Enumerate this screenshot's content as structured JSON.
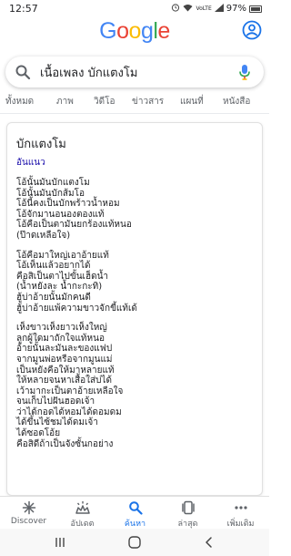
{
  "status_bar": {
    "time": "12:57",
    "battery": "97%",
    "network": "VoLTE"
  },
  "header": {
    "logo_letters": [
      {
        "char": "G",
        "color": "#4285F4"
      },
      {
        "char": "o",
        "color": "#EA4335"
      },
      {
        "char": "o",
        "color": "#FBBC05"
      },
      {
        "char": "g",
        "color": "#4285F4"
      },
      {
        "char": "l",
        "color": "#34A853"
      },
      {
        "char": "e",
        "color": "#EA4335"
      }
    ],
    "account_icon": "account-circle-icon"
  },
  "search": {
    "query": "เนื้อเพลง บักแตงโม"
  },
  "tabs": [
    "ทั้งหมด",
    "ภาพ",
    "วิดีโอ",
    "ข่าวสาร",
    "แผนที่",
    "หนังสือ"
  ],
  "result": {
    "title": "บักแตงโม",
    "artist": "อันแนว",
    "stanzas": [
      [
        "โอ้นั้นมันบักแตงโม",
        "โอ้นั้นมันบักส้มโอ",
        "โอ้นี้คงเป็นบักพร้าวน้ำหอม",
        "โอ้จักมานอนองตองแท้",
        "โอ้คือเป็นตามันยกร้องแท้หนอ",
        "(ป๊าดเหลือใจ)"
      ],
      [
        "โอ้คือมาใหญ่เอาอ้ายแท้",
        "โอ้เห็นแล้วอยากได้",
        "คือสิเป็นตาไปขั้นเฮ็ดน้ำ",
        "(น้ำหยังละ น้ำกะกะทิ)",
        "ฮู้บ่าอ้ายนั้นมักคนดี",
        "ฮู้บ่าอ้ายแพ้ความขาวจักขี้แท้เด้"
      ],
      [
        "เห็งขาวเห็งยาวเห็งใหญ่",
        "ลูกผู้ใดมาถักใจแท้หนอ",
        "อ้ายนั้นละมันละของแฟป",
        "จากมูนพ่อหรือจากมูนแม่",
        "เป็นหยังคือให้มาหลายแท้",
        "ให้หลายจนหาเสื้อใส่บ่ได้",
        "เว้ามากะเป็นตาอ้ายเหลือใจ",
        "จนเก็บไปฝันฮอดเจ้า",
        "ว่าได้กอดได้หอมได้ดอมดม",
        "ได้ขึ้นไซ้ชมได้ดมเจ้า",
        "ได้ซอดโอ้ย",
        "คือสิดีถ้าเป็นจังซั้นกอย่าง"
      ]
    ]
  },
  "bottom_nav": [
    {
      "label": "Discover",
      "icon": "discover-icon",
      "active": false
    },
    {
      "label": "อัปเดต",
      "icon": "updates-icon",
      "active": false
    },
    {
      "label": "ค้นหา",
      "icon": "search-icon",
      "active": true
    },
    {
      "label": "ล่าสุด",
      "icon": "recent-icon",
      "active": false
    },
    {
      "label": "เพิ่มเติม",
      "icon": "more-icon",
      "active": false
    }
  ],
  "colors": {
    "accent": "#1a73e8",
    "link": "#1a0dab",
    "text": "#202124",
    "muted": "#5f6368"
  }
}
